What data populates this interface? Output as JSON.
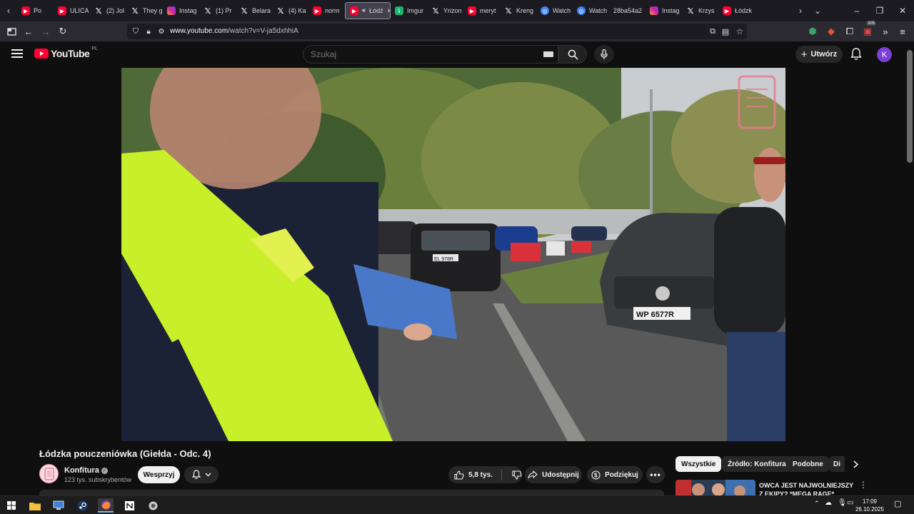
{
  "browser": {
    "tabs": [
      {
        "label": "Po",
        "icon": "youtube-icon"
      },
      {
        "label": "ULICA",
        "icon": "youtube-icon"
      },
      {
        "label": "(2) Jol",
        "icon": "x-icon"
      },
      {
        "label": "They g",
        "icon": "x-icon"
      },
      {
        "label": "Instag",
        "icon": "instagram-icon"
      },
      {
        "label": "(1) Pr",
        "icon": "x-icon"
      },
      {
        "label": "Belara",
        "icon": "x-icon"
      },
      {
        "label": "(4) Ka",
        "icon": "x-icon"
      },
      {
        "label": "norm",
        "icon": "youtube-icon"
      },
      {
        "label": "Łódź",
        "icon": "youtube-icon",
        "active": true
      },
      {
        "label": "Imgur",
        "icon": "imgur-icon"
      },
      {
        "label": "Yrizon",
        "icon": "x-icon"
      },
      {
        "label": "meryt",
        "icon": "youtube-icon"
      },
      {
        "label": "Kreng",
        "icon": "x-icon"
      },
      {
        "label": "Watch",
        "icon": "globe-icon"
      },
      {
        "label": "Watch",
        "icon": "globe-icon"
      },
      {
        "label": "28ba54a2",
        "icon": "none"
      },
      {
        "label": "Instag",
        "icon": "instagram-icon"
      },
      {
        "label": "Krzys",
        "icon": "x-icon"
      },
      {
        "label": "Łódzk",
        "icon": "youtube-icon"
      }
    ],
    "url_domain": "www.youtube.com",
    "url_path": "/watch?v=V-ja5dxhhiA",
    "badge_count": "305"
  },
  "youtube": {
    "logo": "YouTube",
    "region": "PL",
    "search_placeholder": "Szukaj",
    "create_label": "Utwórz",
    "avatar_letter": "K"
  },
  "video": {
    "title": "Łódzka pouczeniówka (Giełda - Odc. 4)",
    "plate_left": "EL 978R",
    "plate_right": "WP 6577R"
  },
  "channel": {
    "name": "Konfitura",
    "subscribers": "123 tys. subskrybentów",
    "support_label": "Wesprzyj"
  },
  "actions": {
    "likes": "5,8 tys.",
    "share": "Udostępnij",
    "thanks": "Podziękuj"
  },
  "chips": [
    "Wszystkie",
    "Źródło: Konfitura",
    "Podobne",
    "Di"
  ],
  "recommendation": {
    "title": "OWCA JEST NAJWOLNIEJSZY Z EKIPY? *MEGA RAGE*"
  },
  "taskbar": {
    "time": "17:09",
    "date": "26.10.2025"
  },
  "colors": {
    "youtube_red": "#ff0033",
    "avatar_purple": "#7b3fd6",
    "bg": "#0f0f0f"
  }
}
